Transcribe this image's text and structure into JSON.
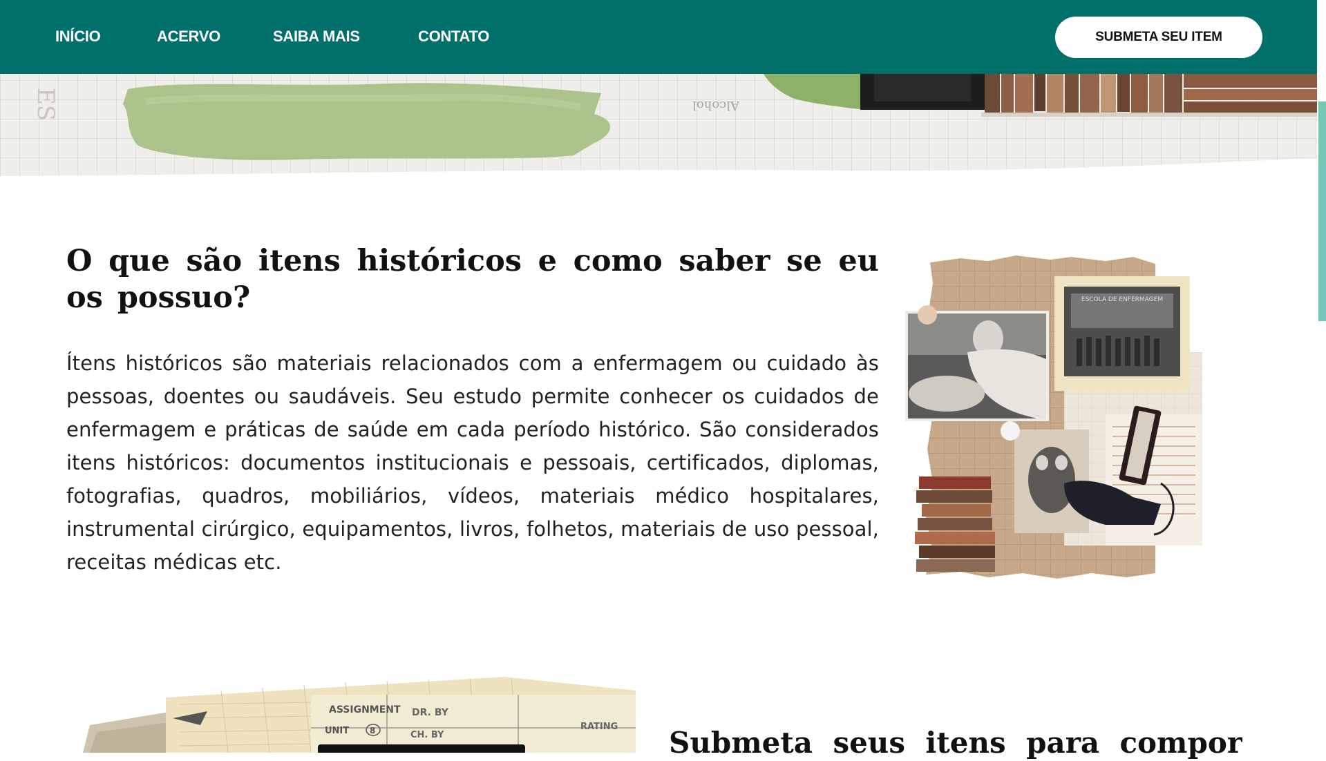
{
  "nav": {
    "items": [
      {
        "label": "INÍCIO"
      },
      {
        "label": "ACERVO"
      },
      {
        "label": "SAIBA MAIS"
      },
      {
        "label": "CONTATO"
      }
    ],
    "cta_label": "SUBMETA SEU ITEM"
  },
  "colors": {
    "nav_bg": "#02706a",
    "accent": "#73c8b6",
    "text": "#111111"
  },
  "hero": {
    "image": "collage-banner-image"
  },
  "section1": {
    "title": "O que são itens históricos e como saber se eu os possuo?",
    "body": "Ítens históricos são materiais relacionados com a enfermagem ou cuidado às pessoas, doentes ou saudáveis. Seu estudo permite conhecer os cuidados de enfermagem e práticas de saúde em cada período histórico. São considerados itens históricos: documentos institucionais e pessoais, certificados, diplomas, fotografias, quadros, mobiliários, vídeos, materiais médico hospitalares, instrumental cirúrgico, equipamentos, livros, folhetos, materiais de uso pessoal, receitas médicas etc.",
    "collage_photo_label": "ESCOLA DE ENFERMAGEM"
  },
  "section2": {
    "title": "Submeta seus itens para compor",
    "card_labels": {
      "assignment": "ASSIGNMENT",
      "unit": "UNIT",
      "unit_value": "8",
      "dr_by": "DR. BY",
      "ch_by": "CH. BY",
      "rating": "RATING"
    }
  }
}
